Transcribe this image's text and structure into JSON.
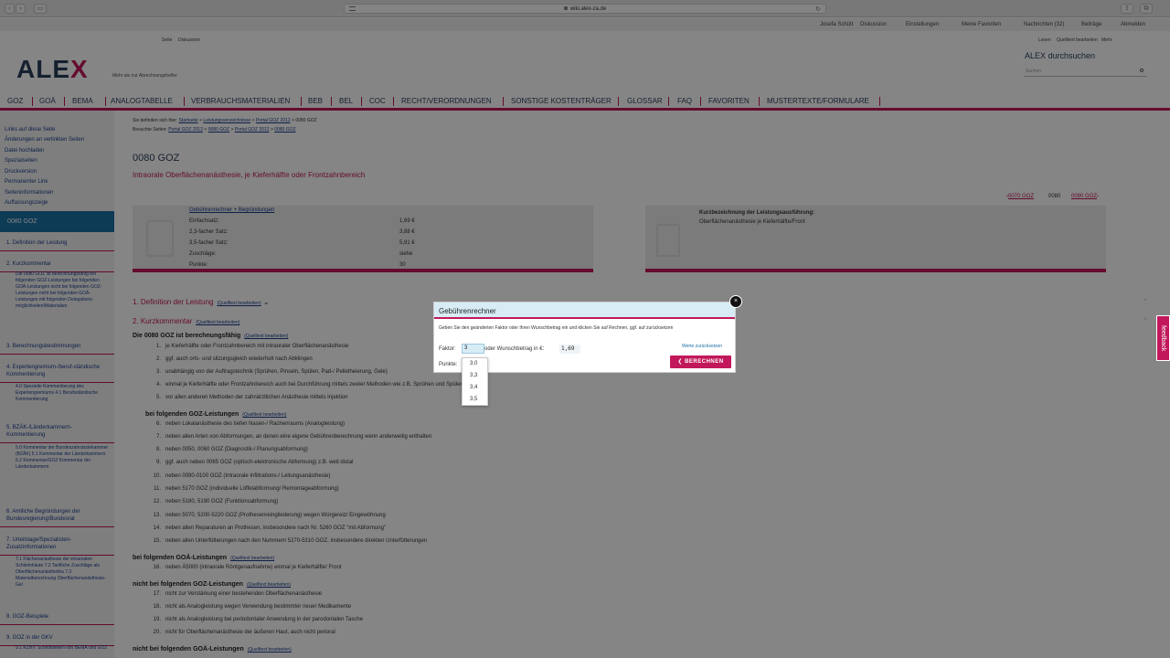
{
  "browser": {
    "url": "wiki.alex-za.de"
  },
  "userbar": [
    "Josefa Schütt",
    "Diskussion",
    "Einstellungen",
    "Meine Favoriten",
    "Nachrichten (32)",
    "Beiträge",
    "Abmelden"
  ],
  "subbar": {
    "left": [
      "Seite",
      "Diskussion"
    ],
    "right": [
      "Lesen",
      "Quelltext bearbeiten",
      "Mehr"
    ]
  },
  "logo": {
    "text": "ALE",
    "x": "X",
    "tagline": "Mehr als nur Abrechnungshelfer"
  },
  "search": {
    "title": "ALEX durchsuchen",
    "placeholder": "Suchen"
  },
  "nav": [
    "GOZ",
    "GOÄ",
    "BEMA",
    "Analogtabelle",
    "Verbrauchsmaterialien",
    "BEB",
    "BEL",
    "COC",
    "Recht/Verordnungen",
    "Sonstige Kostenträger",
    "Glossar",
    "FAQ",
    "Favoriten",
    "Mustertexte/Formulare"
  ],
  "sidebar": {
    "links": [
      "Links auf diese Seite",
      "Änderungen an verlinkten Seiten",
      "Datei hochladen",
      "Spezialseiten",
      "Druckversion",
      "Permanenter Link",
      "Seiteninformationen",
      "Auffassungszeige"
    ],
    "active": "0080 GOZ",
    "sections": [
      {
        "label": "1. Definition der Leistung",
        "sub": ""
      },
      {
        "label": "2. Kurzkommentar",
        "sub": "Die 0080 GOZ ist berechnungsfähig bei folgenden GOZ-Leistungen bei folgenden GOÄ-Leistungen nicht bei folgenden GOZ-Leistungen nicht bei folgenden GOÄ-Leistungen mit folgenden Delegations-möglichkeiten/Materialien"
      },
      {
        "label": "3. Berechnungsbestimmungen",
        "sub": ""
      },
      {
        "label": "4. Expertengremium-/beruf-ständische Kommentierung",
        "sub": "4.0 Spezielle Kommentierung des Expertengremiums 4.1 Berufsständische Kommentierung"
      },
      {
        "label": "5. BZÄK-/Länderkammern-Kommentierung",
        "sub": "5.0 Kommentar der Bundeszahnärztekammer (BZÄK) 5.1 Kommentar der Länderkammern 5.2 Kommentar/GOZ Kommentar der Länderkammern"
      },
      {
        "label": "6. Amtliche Begründungen der Bundesregierung/Bundesrat",
        "sub": ""
      },
      {
        "label": "7. Urteilslage/Spezialisten-Zusatzinformationen",
        "sub": "7.1 Flächenanästhesie der intraoralen Schleimhäute 7.2 Tarifliche Zuschläge als Oberflächenanästhetika 7.3 Materialberechnung Oberflächenanästhesie-Gel"
      },
      {
        "label": "8. GOZ-Beispiele",
        "sub": ""
      },
      {
        "label": "9. GOZ in der GKV",
        "sub": "9.1 KZBV: Schnittstellen von BEMA und GOZ"
      }
    ]
  },
  "breadcrumb": {
    "line1_prefix": "Sie befinden sich hier:",
    "line1": [
      "Startseite",
      "Leistungsverzeichnisse",
      "Portal GOZ 2012",
      "0080 GOZ"
    ],
    "line2_prefix": "Besuchte Seiten:",
    "line2": [
      "Portal GOZ 2012",
      "0080 GOZ",
      "Portal GOZ 2012",
      "0080 GOZ"
    ]
  },
  "page": {
    "title": "0080 GOZ",
    "subtitle": "Intraorale Oberflächenanästhesie, je Kieferhälfte oder Frontzahnbereich",
    "pager_prev": "0070 GOZ",
    "pager_current": "0080",
    "pager_next": "0090 GOZ"
  },
  "fees": {
    "link": "Gebührenrechner + Begründungen",
    "rows": [
      {
        "label": "Einfachsatz:",
        "value": "1,69 €"
      },
      {
        "label": "2,3-facher Satz:",
        "value": "3,88 €"
      },
      {
        "label": "3,5-facher Satz:",
        "value": "5,91 €"
      },
      {
        "label": "Zuschläge:",
        "value": "siehe"
      },
      {
        "label": "Punkte:",
        "value": "30"
      }
    ]
  },
  "shortdesc": {
    "label": "Kurzbezeichnung der Leistungsausführung:",
    "value": "Oberflächenanästhesie je Kieferhälfte/Front"
  },
  "sections": {
    "s1": "1. Definition der Leistung",
    "s2": "2. Kurzkommentar",
    "edit": "(Quelltext bearbeiten)"
  },
  "groups": [
    {
      "title": "Die 0080 GOZ ist berechnungsfähig",
      "items": [
        {
          "n": "1.",
          "t": "je Kieferhälfte oder Frontzahnbereich mit intraoraler Oberflächenanästhesie"
        },
        {
          "n": "2.",
          "t": "ggf. auch orts- und sitzungsgleich wiederholt nach Abklingen"
        },
        {
          "n": "3.",
          "t": "unabhängig von der Auftragstechnik (Sprühen, Pinseln, Spülen, Pad-/ Pelletheierung, Gele)"
        },
        {
          "n": "4.",
          "t": "einmal je Kieferhälfte oder Frontzahnbereich auch bei Durchführung mittels zweier Methoden wie z.B. Sprühen und Spülen etc."
        },
        {
          "n": "5.",
          "t": "vor allen anderen Methoden der zahnärztlichen Anästhesie mittels Injektion"
        }
      ]
    },
    {
      "title": "bei folgenden GOZ-Leistungen",
      "items": [
        {
          "n": "6.",
          "t": "neben Lokalanästhesie des tiefen Nasen-/ Rachenraums (Analogleistung)"
        },
        {
          "n": "7.",
          "t": "neben allen Arten von Abformungen, an denen eine eigene Gebührenberechnung wenn anderweitig enthalten"
        },
        {
          "n": "8.",
          "t": "neben 0050, 0060 GOZ (Diagnostik-/ Planungsabformung)"
        },
        {
          "n": "9.",
          "t": "ggf. auch neben 0065 GOZ (optisch-elektronische Abformung) z.B. weit distal"
        },
        {
          "n": "10.",
          "t": "neben 0090-0100 GOZ (Intraorale Infiltrations-/ Leitungsanästhesie)"
        },
        {
          "n": "11.",
          "t": "neben 5170 GOZ (individuelle Löffelabformung/ Remontageabformung)"
        },
        {
          "n": "12.",
          "t": "neben 5180, 5190 GOZ (Funktionsabformung)"
        },
        {
          "n": "13.",
          "t": "neben 5070, 5200-5220 GOZ (Prothesenreingliederung) wegen Würgereiz/ Eingewöhnung"
        },
        {
          "n": "14.",
          "t": "neben allen Reparaturen an Prothesen, insbesondere nach Nr. 5260 GOZ \"mit Abformung\""
        },
        {
          "n": "15.",
          "t": "neben allen Unterfütterungen nach den Nummern 5270-5310 GOZ, insbesondere direkten Unterfütterungen"
        }
      ]
    },
    {
      "title": "bei folgenden GOÄ-Leistungen",
      "items": [
        {
          "n": "16.",
          "t": "neben Ä5000 (intraorale Röntgenaufnahme) einmal je Kieferhälfte/ Front"
        }
      ]
    },
    {
      "title": "nicht bei folgenden GOZ-Leistungen",
      "items": [
        {
          "n": "17.",
          "t": "nicht zur Verstärkung einer bestehenden Oberflächenanästhesie"
        },
        {
          "n": "18.",
          "t": "nicht als Analogleistung wegen Verwendung bestimmter neuer Medikamente"
        },
        {
          "n": "19.",
          "t": "nicht als Analogleistung bei periodontaler Anwendung in der parodontalen Tasche"
        },
        {
          "n": "20.",
          "t": "nicht für Oberflächenanästhesie der äußeren Haut, auch nicht perioral"
        }
      ]
    },
    {
      "title": "nicht bei folgenden GOÄ-Leistungen",
      "items": []
    }
  ],
  "modal": {
    "title": "Gebührenrechner",
    "close": "×",
    "desc": "Geben Sie den geänderten Faktor oder Ihren Wunschbetrag ein und klicken Sie auf Rechnen, ggf. auf zurücksetzen",
    "factor_label": "Faktor:",
    "factor_value": "3",
    "wish_label": "oder Wunschbetrag in €:",
    "wish_value": "1,69",
    "points_label": "Punkte:",
    "reset": "Werte zurücksetzen",
    "calc": "BERECHNEN",
    "options": [
      "3,0",
      "3,3",
      "3,4",
      "3,5"
    ]
  },
  "feedback": "feedback",
  "colors": {
    "accent": "#c2185b",
    "brand": "#2a3f5a",
    "active": "#1a6fa4",
    "modal_header": "#d7ecf5"
  }
}
